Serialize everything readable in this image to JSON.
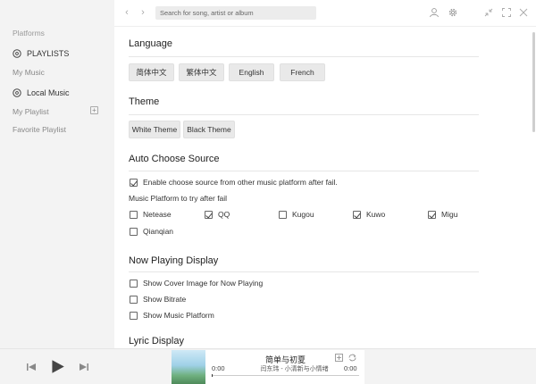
{
  "sidebar": {
    "platforms_heading": "Platforms",
    "playlists_label": "PLAYLISTS",
    "my_music": "My Music",
    "local_music": "Local Music",
    "my_playlist": "My Playlist",
    "add_symbol": "+",
    "favorite_playlist": "Favorite Playlist"
  },
  "topbar": {
    "search_placeholder": "Search for song, artist or album",
    "back_glyph": "‹",
    "forward_glyph": "›"
  },
  "settings": {
    "language": {
      "title": "Language",
      "options": [
        "简体中文",
        "繁体中文",
        "English",
        "French"
      ]
    },
    "theme": {
      "title": "Theme",
      "options": [
        "White Theme",
        "Black Theme"
      ]
    },
    "auto_source": {
      "title": "Auto Choose Source",
      "enable_label": "Enable choose source from other music platform after fail.",
      "enable_checked": true,
      "platforms_label": "Music Platform to try after fail",
      "platforms": [
        {
          "name": "Netease",
          "checked": false
        },
        {
          "name": "QQ",
          "checked": true
        },
        {
          "name": "Kugou",
          "checked": false
        },
        {
          "name": "Kuwo",
          "checked": true
        },
        {
          "name": "Migu",
          "checked": true
        },
        {
          "name": "Qianqian",
          "checked": false
        }
      ]
    },
    "now_playing": {
      "title": "Now Playing Display",
      "options": [
        {
          "label": "Show Cover Image for Now Playing",
          "checked": false
        },
        {
          "label": "Show Bitrate",
          "checked": false
        },
        {
          "label": "Show Music Platform",
          "checked": false
        }
      ]
    },
    "lyric": {
      "title": "Lyric Display"
    }
  },
  "player": {
    "song_title": "简单与初夏",
    "artist": "闫东玮 - 小清新与小情绪",
    "current_time": "0:00",
    "total_time": "0:00",
    "progress": 0
  }
}
